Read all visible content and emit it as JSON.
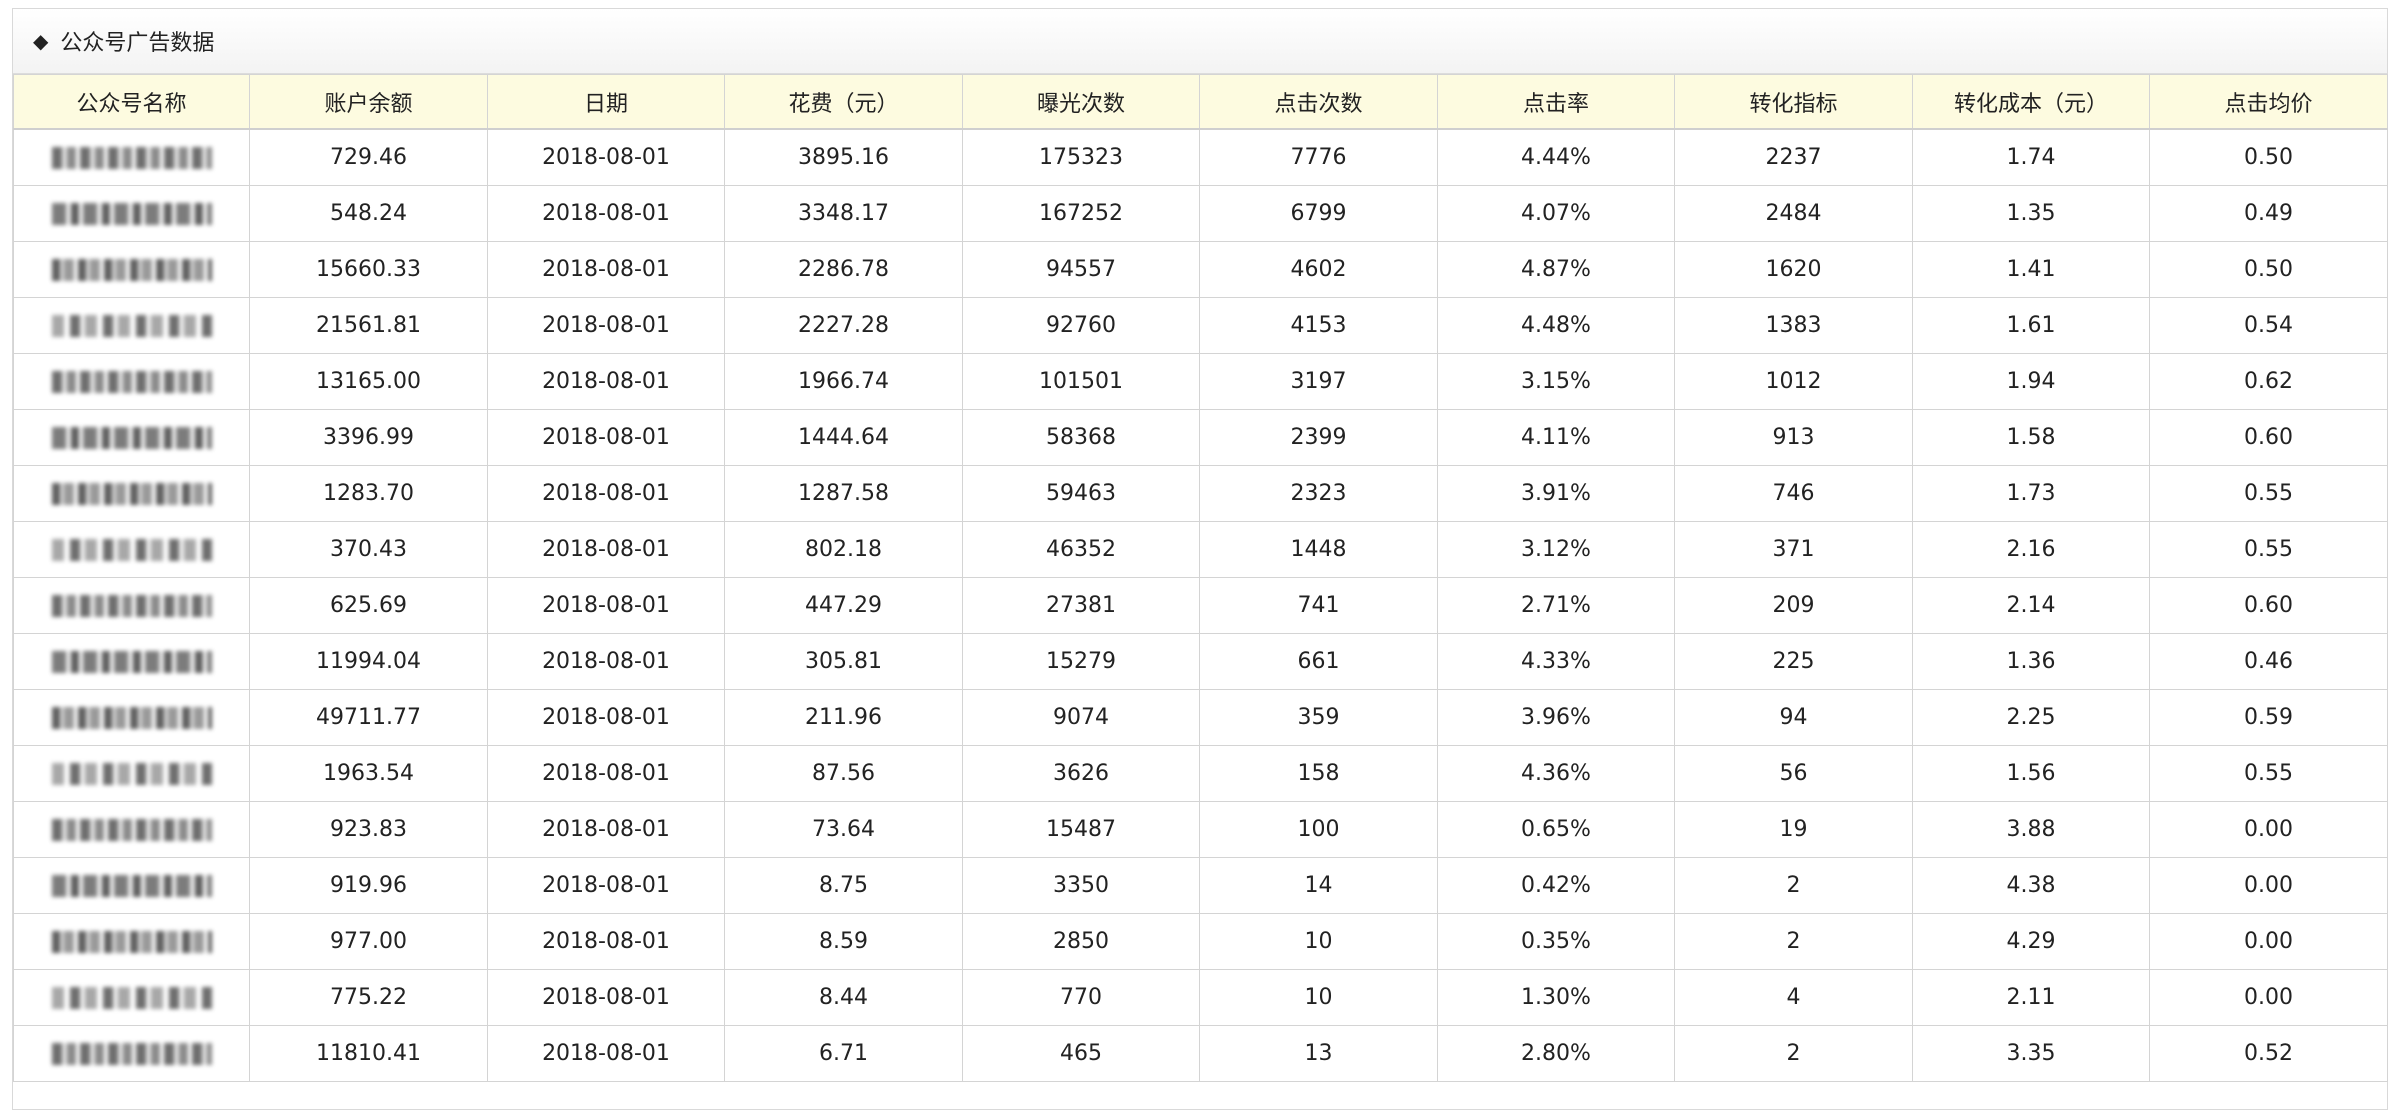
{
  "panel": {
    "title": "公众号广告数据",
    "bullet": "◆"
  },
  "columns": [
    "公众号名称",
    "账户余额",
    "日期",
    "花费（元）",
    "曝光次数",
    "点击次数",
    "点击率",
    "转化指标",
    "转化成本（元）",
    "点击均价"
  ],
  "rows": [
    [
      "729.46",
      "2018-08-01",
      "3895.16",
      "175323",
      "7776",
      "4.44%",
      "2237",
      "1.74",
      "0.50"
    ],
    [
      "548.24",
      "2018-08-01",
      "3348.17",
      "167252",
      "6799",
      "4.07%",
      "2484",
      "1.35",
      "0.49"
    ],
    [
      "15660.33",
      "2018-08-01",
      "2286.78",
      "94557",
      "4602",
      "4.87%",
      "1620",
      "1.41",
      "0.50"
    ],
    [
      "21561.81",
      "2018-08-01",
      "2227.28",
      "92760",
      "4153",
      "4.48%",
      "1383",
      "1.61",
      "0.54"
    ],
    [
      "13165.00",
      "2018-08-01",
      "1966.74",
      "101501",
      "3197",
      "3.15%",
      "1012",
      "1.94",
      "0.62"
    ],
    [
      "3396.99",
      "2018-08-01",
      "1444.64",
      "58368",
      "2399",
      "4.11%",
      "913",
      "1.58",
      "0.60"
    ],
    [
      "1283.70",
      "2018-08-01",
      "1287.58",
      "59463",
      "2323",
      "3.91%",
      "746",
      "1.73",
      "0.55"
    ],
    [
      "370.43",
      "2018-08-01",
      "802.18",
      "46352",
      "1448",
      "3.12%",
      "371",
      "2.16",
      "0.55"
    ],
    [
      "625.69",
      "2018-08-01",
      "447.29",
      "27381",
      "741",
      "2.71%",
      "209",
      "2.14",
      "0.60"
    ],
    [
      "11994.04",
      "2018-08-01",
      "305.81",
      "15279",
      "661",
      "4.33%",
      "225",
      "1.36",
      "0.46"
    ],
    [
      "49711.77",
      "2018-08-01",
      "211.96",
      "9074",
      "359",
      "3.96%",
      "94",
      "2.25",
      "0.59"
    ],
    [
      "1963.54",
      "2018-08-01",
      "87.56",
      "3626",
      "158",
      "4.36%",
      "56",
      "1.56",
      "0.55"
    ],
    [
      "923.83",
      "2018-08-01",
      "73.64",
      "15487",
      "100",
      "0.65%",
      "19",
      "3.88",
      "0.00"
    ],
    [
      "919.96",
      "2018-08-01",
      "8.75",
      "3350",
      "14",
      "0.42%",
      "2",
      "4.38",
      "0.00"
    ],
    [
      "977.00",
      "2018-08-01",
      "8.59",
      "2850",
      "10",
      "0.35%",
      "2",
      "4.29",
      "0.00"
    ],
    [
      "775.22",
      "2018-08-01",
      "8.44",
      "770",
      "10",
      "1.30%",
      "4",
      "2.11",
      "0.00"
    ],
    [
      "11810.41",
      "2018-08-01",
      "6.71",
      "465",
      "13",
      "2.80%",
      "2",
      "3.35",
      "0.52"
    ]
  ],
  "colors": {
    "header_bg": "#fdfbe0",
    "border": "#d4d4d4"
  }
}
